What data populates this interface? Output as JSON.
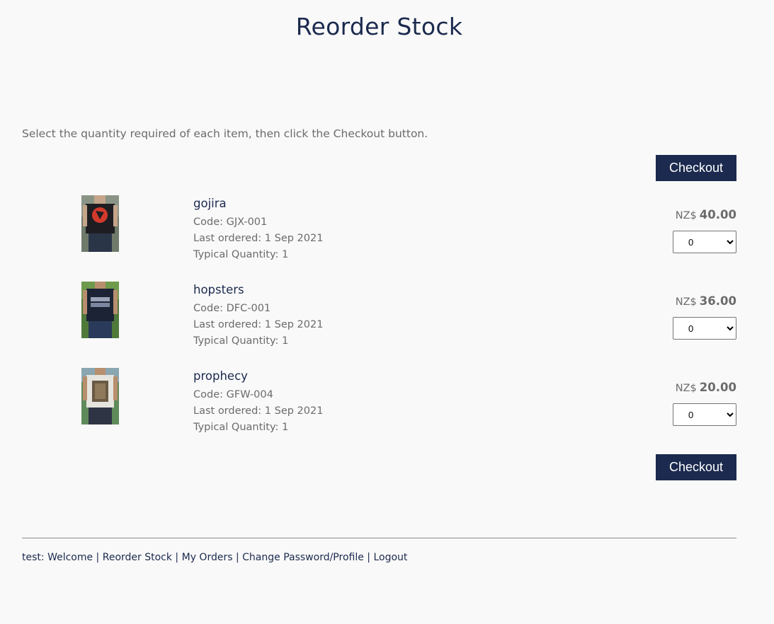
{
  "page": {
    "title": "Reorder Stock",
    "instructions": "Select the quantity required of each item, then click the Checkout button.",
    "checkout_label": "Checkout"
  },
  "products": [
    {
      "name": "gojira",
      "code": "Code: GJX-001",
      "last_ordered": "Last ordered: 1 Sep 2021",
      "typical_quantity": "Typical Quantity: 1",
      "currency": "NZ$",
      "price": "40.00",
      "quantity": "0",
      "image": "black-tshirt-red-logo"
    },
    {
      "name": "hopsters",
      "code": "Code: DFC-001",
      "last_ordered": "Last ordered: 1 Sep 2021",
      "typical_quantity": "Typical Quantity: 1",
      "currency": "NZ$",
      "price": "36.00",
      "quantity": "0",
      "image": "navy-tshirt-print"
    },
    {
      "name": "prophecy",
      "code": "Code: GFW-004",
      "last_ordered": "Last ordered: 1 Sep 2021",
      "typical_quantity": "Typical Quantity: 1",
      "currency": "NZ$",
      "price": "20.00",
      "quantity": "0",
      "image": "white-tshirt-print"
    }
  ],
  "footer": {
    "user_prefix": "test: ",
    "links": [
      "Welcome",
      "Reorder Stock",
      "My Orders",
      "Change Password/Profile",
      "Logout"
    ],
    "separator": " | "
  },
  "colors": {
    "primary": "#1b2a4e",
    "text_muted": "#6b6b6b",
    "background": "#f9f9f9"
  }
}
